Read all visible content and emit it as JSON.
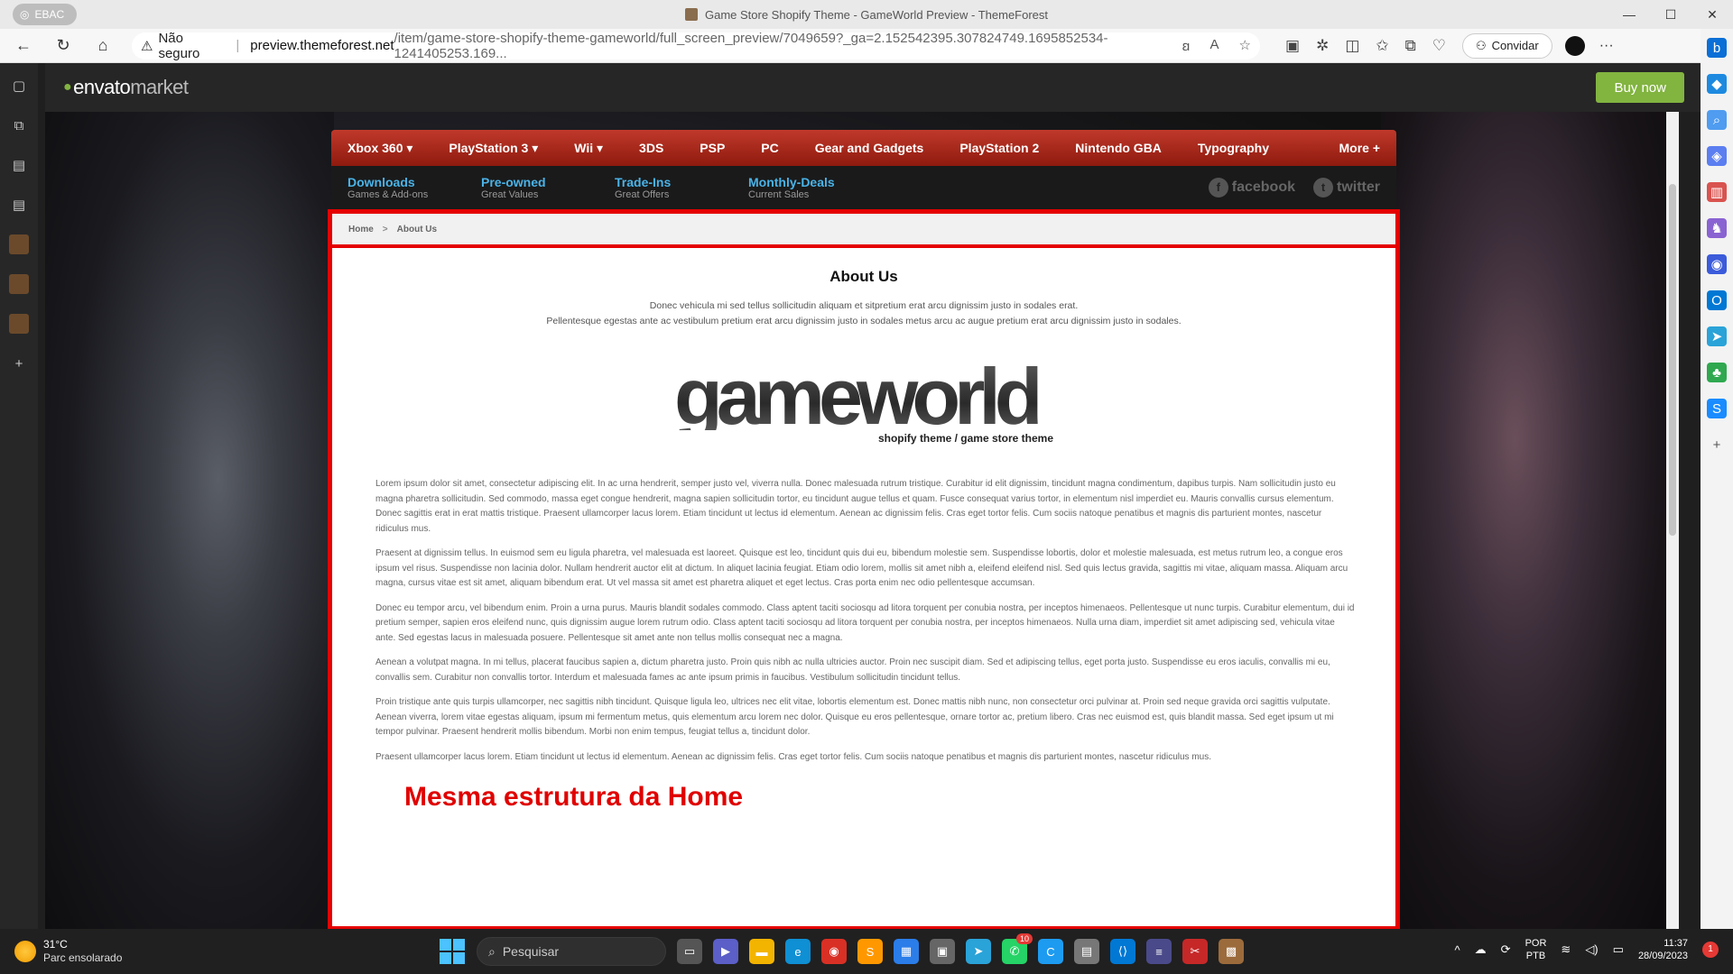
{
  "browser": {
    "profile_label": "EBAC",
    "window_title": "Game Store Shopify Theme - GameWorld Preview - ThemeForest",
    "not_secure_label": "Não seguro",
    "url_domain": "preview.themeforest.net",
    "url_path": "/item/game-store-shopify-theme-gameworld/full_screen_preview/7049659?_ga=2.152542395.307824749.1695852534-1241405253.169...",
    "invite_label": "Convidar"
  },
  "envato": {
    "logo_main": "envato",
    "logo_sub": "market",
    "buy_now_label": "Buy now"
  },
  "main_nav": {
    "items": [
      "Xbox 360 ▾",
      "PlayStation 3 ▾",
      "Wii ▾",
      "3DS",
      "PSP",
      "PC",
      "Gear and Gadgets",
      "PlayStation 2",
      "Nintendo GBA",
      "Typography"
    ],
    "more_label": "More +"
  },
  "sub_nav": {
    "items": [
      {
        "title": "Downloads",
        "desc": "Games & Add-ons"
      },
      {
        "title": "Pre-owned",
        "desc": "Great Values"
      },
      {
        "title": "Trade-Ins",
        "desc": "Great Offers"
      },
      {
        "title": "Monthly-Deals",
        "desc": "Current Sales"
      }
    ],
    "facebook_label": "facebook",
    "twitter_label": "twitter"
  },
  "breadcrumb": {
    "home": "Home",
    "separator": ">",
    "current": "About Us"
  },
  "page": {
    "title": "About Us",
    "intro_line1": "Donec vehicula mi sed tellus sollicitudin aliquam et sitpretium erat arcu dignissim justo in sodales erat.",
    "intro_line2": "Pellentesque egestas ante ac vestibulum pretium erat arcu dignissim justo in sodales metus arcu ac augue pretium erat arcu dignissim justo in sodales.",
    "logo_text": "gameworld",
    "logo_tagline": "shopify theme / game store theme",
    "paragraphs": [
      "Lorem ipsum dolor sit amet, consectetur adipiscing elit. In ac urna hendrerit, semper justo vel, viverra nulla. Donec malesuada rutrum tristique. Curabitur id elit dignissim, tincidunt magna condimentum, dapibus turpis. Nam sollicitudin justo eu magna pharetra sollicitudin. Sed commodo, massa eget congue hendrerit, magna sapien sollicitudin tortor, eu tincidunt augue tellus et quam. Fusce consequat varius tortor, in elementum nisl imperdiet eu. Mauris convallis cursus elementum. Donec sagittis erat in erat mattis tristique. Praesent ullamcorper lacus lorem. Etiam tincidunt ut lectus id elementum. Aenean ac dignissim felis. Cras eget tortor felis. Cum sociis natoque penatibus et magnis dis parturient montes, nascetur ridiculus mus.",
      "Praesent at dignissim tellus. In euismod sem eu ligula pharetra, vel malesuada est laoreet. Quisque est leo, tincidunt quis dui eu, bibendum molestie sem. Suspendisse lobortis, dolor et molestie malesuada, est metus rutrum leo, a congue eros ipsum vel risus. Suspendisse non lacinia dolor. Nullam hendrerit auctor elit at dictum. In aliquet lacinia feugiat. Etiam odio lorem, mollis sit amet nibh a, eleifend eleifend nisl. Sed quis lectus gravida, sagittis mi vitae, aliquam massa. Aliquam arcu magna, cursus vitae est sit amet, aliquam bibendum erat. Ut vel massa sit amet est pharetra aliquet et eget lectus. Cras porta enim nec odio pellentesque accumsan.",
      "Donec eu tempor arcu, vel bibendum enim. Proin a urna purus. Mauris blandit sodales commodo. Class aptent taciti sociosqu ad litora torquent per conubia nostra, per inceptos himenaeos. Pellentesque ut nunc turpis. Curabitur elementum, dui id pretium semper, sapien eros eleifend nunc, quis dignissim augue lorem rutrum odio. Class aptent taciti sociosqu ad litora torquent per conubia nostra, per inceptos himenaeos. Nulla urna diam, imperdiet sit amet adipiscing sed, vehicula vitae ante. Sed egestas lacus in malesuada posuere. Pellentesque sit amet ante non tellus mollis consequat nec a magna.",
      "Aenean a volutpat magna. In mi tellus, placerat faucibus sapien a, dictum pharetra justo. Proin quis nibh ac nulla ultricies auctor. Proin nec suscipit diam. Sed et adipiscing tellus, eget porta justo. Suspendisse eu eros iaculis, convallis mi eu, convallis sem. Curabitur non convallis tortor. Interdum et malesuada fames ac ante ipsum primis in faucibus. Vestibulum sollicitudin tincidunt tellus.",
      "Proin tristique ante quis turpis ullamcorper, nec sagittis nibh tincidunt. Quisque ligula leo, ultrices nec elit vitae, lobortis elementum est. Donec mattis nibh nunc, non consectetur orci pulvinar at. Proin sed neque gravida orci sagittis vulputate. Aenean viverra, lorem vitae egestas aliquam, ipsum mi fermentum metus, quis elementum arcu lorem nec dolor. Quisque eu eros pellentesque, ornare tortor ac, pretium libero. Cras nec euismod est, quis blandit massa. Sed eget ipsum ut mi tempor pulvinar. Praesent hendrerit mollis bibendum. Morbi non enim tempus, feugiat tellus a, tincidunt dolor.",
      "Praesent ullamcorper lacus lorem. Etiam tincidunt ut lectus id elementum. Aenean ac dignissim felis. Cras eget tortor felis. Cum sociis natoque penatibus et magnis dis parturient montes, nascetur ridiculus mus."
    ],
    "annotation": "Mesma estrutura da Home"
  },
  "taskbar": {
    "temperature": "31°C",
    "weather_condition": "Parc ensolarado",
    "search_placeholder": "Pesquisar",
    "whatsapp_badge": "10",
    "lang_top": "POR",
    "lang_bottom": "PTB",
    "time": "11:37",
    "date": "28/09/2023",
    "notification_count": "1"
  },
  "colors": {
    "accent_red": "#e50000",
    "nav_red": "#c0392b",
    "envato_green": "#82b440",
    "subnav_blue": "#4ab3e8"
  }
}
